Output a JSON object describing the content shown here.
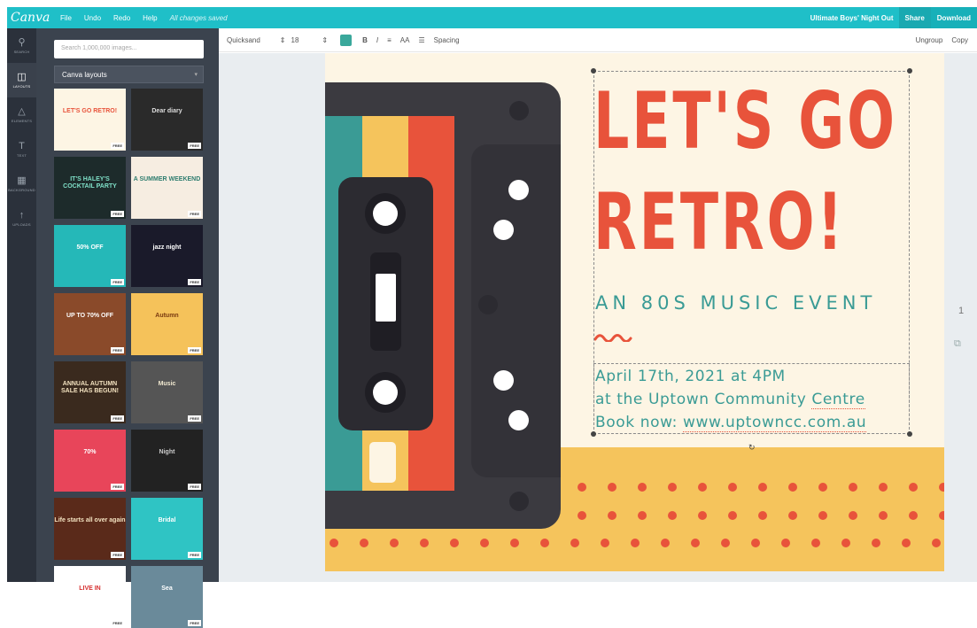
{
  "topbar": {
    "logo": "Canva",
    "menu": [
      "File",
      "Undo",
      "Redo",
      "Help"
    ],
    "saved_status": "All changes saved",
    "doc_title": "Ultimate Boys' Night Out",
    "share_label": "Share",
    "download_label": "Download"
  },
  "rail": [
    {
      "icon": "search-icon",
      "glyph": "⚲",
      "label": "SEARCH"
    },
    {
      "icon": "layouts-icon",
      "glyph": "◫",
      "label": "LAYOUTS"
    },
    {
      "icon": "elements-icon",
      "glyph": "△",
      "label": "ELEMENTS"
    },
    {
      "icon": "text-icon",
      "glyph": "T",
      "label": "TEXT"
    },
    {
      "icon": "background-icon",
      "glyph": "▦",
      "label": "BACKGROUND"
    },
    {
      "icon": "uploads-icon",
      "glyph": "↑",
      "label": "UPLOADS"
    }
  ],
  "panel": {
    "search_placeholder": "Search 1,000,000 images...",
    "layout_select": "Canva layouts",
    "thumb_free_label": "FREE",
    "thumbs": [
      {
        "text": "LET'S GO RETRO!",
        "bg": "#fdf5e4",
        "fg": "#e8533b"
      },
      {
        "text": "Dear diary",
        "bg": "#2a2a2a",
        "fg": "#dddddd"
      },
      {
        "text": "IT'S HALEY'S COCKTAIL PARTY",
        "bg": "#1d2b2b",
        "fg": "#7fe0c8"
      },
      {
        "text": "A SUMMER WEEKEND",
        "bg": "#f6ede1",
        "fg": "#2f7d6f"
      },
      {
        "text": "50% OFF",
        "bg": "#25b8b8",
        "fg": "#ffffff"
      },
      {
        "text": "jazz night",
        "bg": "#1a1a2a",
        "fg": "#ffffff"
      },
      {
        "text": "UP TO 70% OFF",
        "bg": "#8a4a2a",
        "fg": "#ffffff"
      },
      {
        "text": "Autumn",
        "bg": "#f5c25a",
        "fg": "#7a3a10"
      },
      {
        "text": "ANNUAL AUTUMN SALE HAS BEGUN!",
        "bg": "#3a2a1e",
        "fg": "#f3e2c0"
      },
      {
        "text": "Music",
        "bg": "#555555",
        "fg": "#f0e8d0"
      },
      {
        "text": "70%",
        "bg": "#e8455a",
        "fg": "#ffffff"
      },
      {
        "text": "Night",
        "bg": "#222222",
        "fg": "#cccccc"
      },
      {
        "text": "Life starts all over again",
        "bg": "#5a2a1a",
        "fg": "#f3e2c0"
      },
      {
        "text": "Bridal",
        "bg": "#2fc4c4",
        "fg": "#ffffff"
      },
      {
        "text": "LIVE IN",
        "bg": "#ffffff",
        "fg": "#d63030"
      },
      {
        "text": "Sea",
        "bg": "#6a8a9a",
        "fg": "#ffffff"
      }
    ]
  },
  "toolbar": {
    "font": "Quicksand",
    "size": "18",
    "bold": "B",
    "italic": "I",
    "align": "≡",
    "case": "AA",
    "list": "☰",
    "spacing": "Spacing",
    "ungroup": "Ungroup",
    "copy": "Copy",
    "text_color": "#3aa89b"
  },
  "design": {
    "title_line1": "LET'S GO",
    "title_line2": "RETRO!",
    "subtitle": "AN 80S MUSIC EVENT",
    "info_line1": "April 17th, 2021 at 4PM",
    "info_line2_a": "at the Uptown Community ",
    "info_line2_b": "Centre",
    "info_line3_a": "Book now: ",
    "info_line3_b": "www.uptowncc.com.au",
    "colors": {
      "red": "#e8533b",
      "teal": "#3a9b95",
      "yellow": "#f5c45c",
      "cream": "#fdf5e4",
      "dark": "#3b3a40"
    }
  },
  "side": {
    "page_number": "1"
  }
}
